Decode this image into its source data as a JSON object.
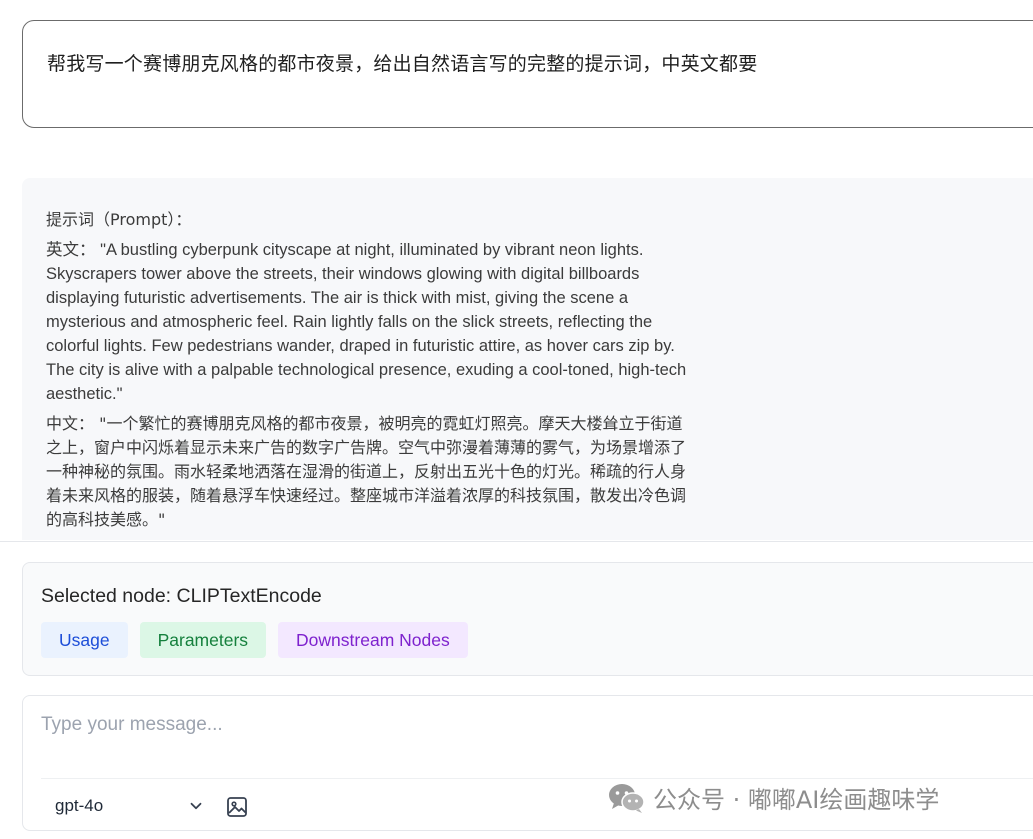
{
  "user_message": {
    "text": "帮我写一个赛博朋克风格的都市夜景，给出自然语言写的完整的提示词，中英文都要"
  },
  "assistant_message": {
    "heading": "提示词（Prompt）：",
    "english": "英文：  \"A bustling cyberpunk cityscape at night, illuminated by vibrant neon lights. Skyscrapers tower above the streets, their windows glowing with digital billboards displaying futuristic advertisements. The air is thick with mist, giving the scene a mysterious and atmospheric feel. Rain lightly falls on the slick streets, reflecting the colorful lights. Few pedestrians wander, draped in futuristic attire, as hover cars zip by. The city is alive with a palpable technological presence, exuding a cool-toned, high-tech aesthetic.\"",
    "chinese": "中文：  \"一个繁忙的赛博朋克风格的都市夜景，被明亮的霓虹灯照亮。摩天大楼耸立于街道之上，窗户中闪烁着显示未来广告的数字广告牌。空气中弥漫着薄薄的雾气，为场景增添了一种神秘的氛围。雨水轻柔地洒落在湿滑的街道上，反射出五光十色的灯光。稀疏的行人身着未来风格的服装，随着悬浮车快速经过。整座城市洋溢着浓厚的科技氛围，散发出冷色调的高科技美感。\""
  },
  "node_panel": {
    "title": "Selected node: CLIPTextEncode",
    "tabs": {
      "usage": "Usage",
      "parameters": "Parameters",
      "downstream": "Downstream Nodes"
    }
  },
  "composer": {
    "placeholder": "Type your message...",
    "model": "gpt-4o",
    "model_icon": "chevron-down-icon",
    "attach_icon": "image-icon"
  },
  "watermark": {
    "text": "公众号 · 嘟嘟AI绘画趣味学",
    "icon": "wechat-icon"
  },
  "colors": {
    "usage_bg": "#eaf2fe",
    "usage_text": "#1d4ed8",
    "parameters_bg": "#dcf7e6",
    "parameters_text": "#15803d",
    "downstream_bg": "#f3e8ff",
    "downstream_text": "#7e22ce",
    "assistant_bg": "#f7f8fa"
  }
}
